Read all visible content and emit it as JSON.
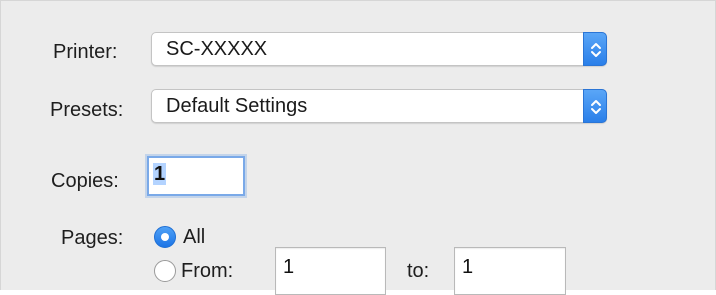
{
  "printer": {
    "label": "Printer:",
    "value": "SC-XXXXX",
    "stepper_icon": "updown-chevron-icon"
  },
  "presets": {
    "label": "Presets:",
    "value": "Default Settings",
    "stepper_icon": "updown-chevron-icon"
  },
  "copies": {
    "label": "Copies:",
    "value": "1"
  },
  "pages": {
    "label": "Pages:",
    "all_label": "All",
    "all_selected": true,
    "from_label": "From:",
    "from_value": "1",
    "to_label": "to:",
    "to_value": "1"
  },
  "colors": {
    "accent": "#2a7fe9",
    "background": "#ececec"
  }
}
